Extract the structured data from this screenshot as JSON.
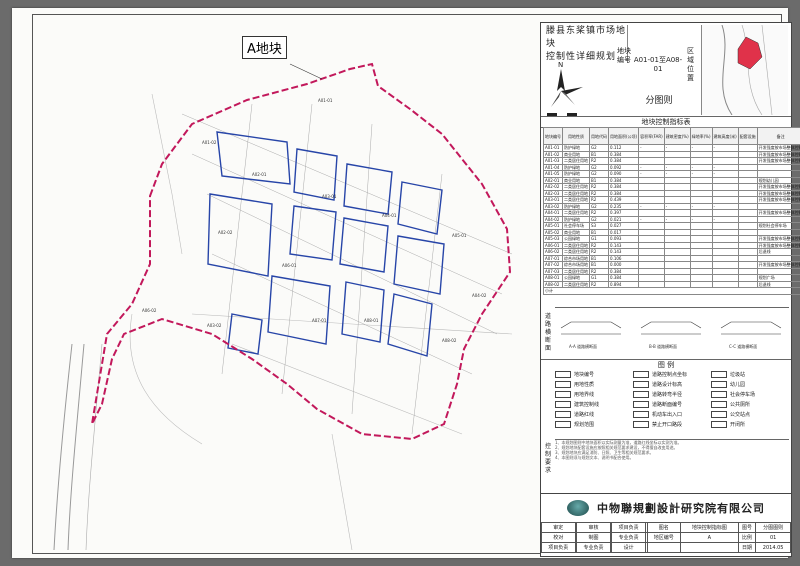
{
  "title": {
    "line1": "滕县东桨镇市场地块",
    "line2": "控制性详细规划"
  },
  "compass": {
    "north": "N"
  },
  "plot": {
    "label": "地块编号",
    "value": "A01-01至A08-01"
  },
  "region": {
    "label": "区域位置"
  },
  "sheet_title": "分图则",
  "control_table": {
    "title": "地块控制指标表",
    "headers": [
      "地块编号",
      "用地性质",
      "用地代码",
      "用地面积(公顷)",
      "容积率(FAR)",
      "建筑密度(%)",
      "绿地率(%)",
      "建筑高度(米)",
      "配套设施",
      "备注"
    ],
    "rows": [
      [
        "A01-01",
        "防护绿地",
        "G2",
        "0.112",
        "-",
        "-",
        "-",
        "-",
        "",
        "开发强度按市场整体控制"
      ],
      [
        "A01-02",
        "商业用地",
        "B1",
        "0.384",
        "",
        "",
        "",
        "",
        "",
        "开发强度按市场整体控制"
      ],
      [
        "A01-03",
        "二类居住用地",
        "R2",
        "0.384",
        "",
        "",
        "",
        "",
        "",
        "开发强度按市场整体控制"
      ],
      [
        "A01-04",
        "防护绿地",
        "G2",
        "0.092",
        "-",
        "-",
        "-",
        "-",
        "",
        ""
      ],
      [
        "A01-05",
        "防护绿地",
        "G2",
        "0.090",
        "-",
        "-",
        "-",
        "-",
        "",
        ""
      ],
      [
        "A02-01",
        "商业用地",
        "B1",
        "0.384",
        "",
        "",
        "",
        "",
        "",
        "规划幼儿园"
      ],
      [
        "A02-02",
        "二类居住用地",
        "R2",
        "0.384",
        "",
        "",
        "",
        "",
        "",
        "开发强度按市场整体控制"
      ],
      [
        "A02-03",
        "二类居住用地",
        "R2",
        "0.384",
        "",
        "",
        "",
        "",
        "",
        "开发强度按市场整体控制"
      ],
      [
        "A03-01",
        "二类居住用地",
        "R2",
        "0.439",
        "",
        "",
        "",
        "",
        "",
        "开发强度按市场整体控制"
      ],
      [
        "A03-02",
        "防护绿地",
        "G2",
        "0.235",
        "-",
        "-",
        "-",
        "-",
        "",
        ""
      ],
      [
        "A04-01",
        "二类居住用地",
        "R2",
        "0.397",
        "",
        "",
        "",
        "",
        "",
        "开发强度按市场整体控制"
      ],
      [
        "A04-02",
        "防护绿地",
        "G2",
        "0.021",
        "-",
        "-",
        "-",
        "-",
        "",
        ""
      ],
      [
        "A05-01",
        "社会停车场",
        "S3",
        "0.027",
        "",
        "",
        "",
        "",
        "",
        "规划社会停车场"
      ],
      [
        "A05-02",
        "商业用地",
        "B1",
        "0.017",
        "",
        "",
        "",
        "",
        "",
        ""
      ],
      [
        "A05-03",
        "公园绿地",
        "G1",
        "0.093",
        "",
        "",
        "",
        "",
        "",
        "开发强度按市场整体控制"
      ],
      [
        "A06-01",
        "二类居住用地",
        "R2",
        "0.143",
        "",
        "",
        "",
        "",
        "",
        "开发强度按市场整体控制"
      ],
      [
        "A06-02",
        "二类居住用地",
        "R2",
        "0.143",
        "",
        "",
        "",
        "",
        "",
        "后退线"
      ],
      [
        "A07-01",
        "综合市场用地",
        "B1",
        "0.106",
        "",
        "",
        "",
        "",
        "",
        ""
      ],
      [
        "A07-02",
        "综合市场用地",
        "B1",
        "0.000",
        "",
        "",
        "",
        "",
        "",
        "开发强度按市场整体控制"
      ],
      [
        "A07-03",
        "二类居住用地",
        "R2",
        "0.384",
        "",
        "",
        "",
        "",
        "",
        ""
      ],
      [
        "A08-01",
        "公园绿地",
        "G1",
        "0.384",
        "",
        "",
        "",
        "",
        "",
        "规划广场"
      ],
      [
        "A08-02",
        "二类居住用地",
        "R2",
        "0.894",
        "",
        "",
        "",
        "",
        "",
        "后退线"
      ]
    ],
    "total": "小计"
  },
  "section_labels": {
    "road": "道路横断面",
    "legend": "图例",
    "control": "控制要求"
  },
  "road_sections": [
    "A-A 道路横断面",
    "B-B 道路横断面",
    "C-C 道路横断面"
  ],
  "legend": {
    "title": "图 例",
    "items": [
      "地块编号",
      "用地性质",
      "用地界线",
      "建筑控制线",
      "道路红线",
      "规划范围",
      "道路控制点坐标",
      "道路设计标高",
      "道路转弯半径",
      "道路断面编号",
      "机动车出入口",
      "禁止开口路段",
      "垃圾站",
      "幼儿园",
      "社会停车场",
      "公共厕所",
      "公交站点",
      "开闭所"
    ]
  },
  "notes": [
    "1、本规划图则中地块面积以实际测量为准，道路红线坐标以实测为准。",
    "2、规划地块配套设施应按照相关规范要求建设，不得擅自改变用途。",
    "3、规划地块应满足消防、日照、卫生等相关规范要求。",
    "4、本图则须与规划文本、说明书配合使用。"
  ],
  "company": "中物聯規劃設計研究院有限公司",
  "signatures": [
    [
      "审定",
      "",
      "审核",
      "",
      "项目负责",
      "",
      "图名",
      "地块控制指标图",
      "图号",
      "分图图则"
    ],
    [
      "校对",
      "",
      "制图",
      "",
      "专业负责",
      "",
      "地区编号",
      "A",
      "比例",
      "01"
    ],
    [
      "项目负责",
      "",
      "专业负责",
      "",
      "设计",
      "",
      "",
      "",
      "日期",
      "2014.05"
    ]
  ],
  "map": {
    "area_label": "A地块",
    "block_labels": [
      "A01-01",
      "A01-02",
      "A02-01",
      "A02-02",
      "A03-01",
      "A04-01",
      "A05-01",
      "A06-01",
      "A07-01",
      "A08-01",
      "A03-02",
      "A04-02",
      "A06-02",
      "A08-02"
    ]
  },
  "colors": {
    "boundary": "#c2185b",
    "road": "#2745a8",
    "inset_area": "#e0324a"
  }
}
